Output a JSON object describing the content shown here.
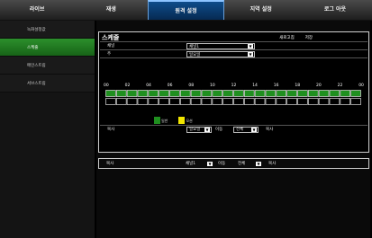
{
  "topbar": {
    "tabs": [
      "라이브",
      "재생",
      "원격 설정",
      "지역 설정",
      "로그 아웃"
    ],
    "active_index": 2
  },
  "sidebar": {
    "items": [
      {
        "label": "디스플레이",
        "icon": "monitor-icon"
      },
      {
        "label": "녹화",
        "icon": "film-reel-icon"
      },
      {
        "label": "녹화설정값",
        "sub": true
      },
      {
        "label": "스케줄",
        "sub": true,
        "active": true
      },
      {
        "label": "메인스트림",
        "sub": true
      },
      {
        "label": "서브스트림",
        "sub": true
      },
      {
        "label": "Capture",
        "icon": "camera-icon"
      },
      {
        "label": "네트워크",
        "icon": "network-icon"
      },
      {
        "label": "알람",
        "icon": "alarm-icon"
      },
      {
        "label": "장치",
        "icon": "device-icon"
      },
      {
        "label": "시스템",
        "icon": "system-icon"
      },
      {
        "label": "고급",
        "icon": "advanced-icon"
      }
    ]
  },
  "schedule": {
    "title": "스케줄",
    "refresh_label": "새로고침",
    "save_label": "저장",
    "channel_label": "채널",
    "channel_value": "채널1",
    "week_label": "주",
    "week_value": "일요일",
    "hours": [
      "00",
      "02",
      "04",
      "06",
      "08",
      "10",
      "12",
      "14",
      "16",
      "18",
      "20",
      "22",
      "00"
    ],
    "legend": [
      {
        "label": "일반",
        "color": "#1f8f1f"
      },
      {
        "label": "모션",
        "color": "#f2e600"
      }
    ],
    "normal_hours_filled": 24,
    "motion_hours_filled": 0,
    "copy_row": {
      "copy_label": "복사",
      "day_value": "일요일",
      "move_label": "이동",
      "all_value": "전체",
      "copy_btn": "복사"
    }
  },
  "copy_panel": {
    "copy_label": "복사",
    "channel_value": "채널1",
    "move_label": "이동",
    "all_value": "전체",
    "copy_btn": "복사"
  },
  "colors": {
    "active_tab": "#0a3e74",
    "sidebar_active": "#1f7a1f",
    "normal_bar": "#1f8f1f"
  }
}
